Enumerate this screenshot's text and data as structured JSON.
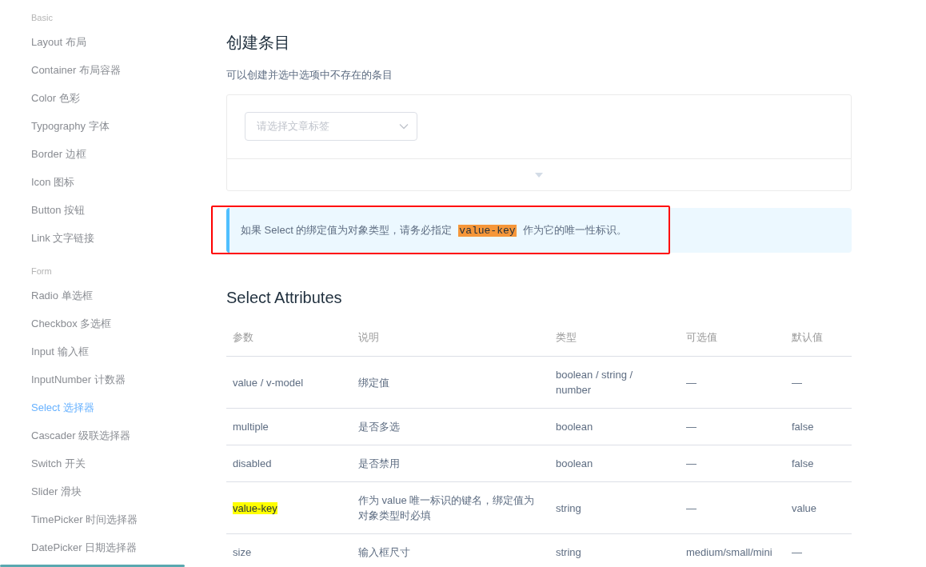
{
  "sidebar": {
    "groups": [
      {
        "title": "Basic",
        "items": [
          {
            "label": "Layout 布局",
            "selected": false
          },
          {
            "label": "Container 布局容器",
            "selected": false
          },
          {
            "label": "Color 色彩",
            "selected": false
          },
          {
            "label": "Typography 字体",
            "selected": false
          },
          {
            "label": "Border 边框",
            "selected": false
          },
          {
            "label": "Icon 图标",
            "selected": false
          },
          {
            "label": "Button 按钮",
            "selected": false
          },
          {
            "label": "Link 文字链接",
            "selected": false
          }
        ]
      },
      {
        "title": "Form",
        "items": [
          {
            "label": "Radio 单选框",
            "selected": false
          },
          {
            "label": "Checkbox 多选框",
            "selected": false
          },
          {
            "label": "Input 输入框",
            "selected": false
          },
          {
            "label": "InputNumber 计数器",
            "selected": false
          },
          {
            "label": "Select 选择器",
            "selected": true
          },
          {
            "label": "Cascader 级联选择器",
            "selected": false
          },
          {
            "label": "Switch 开关",
            "selected": false
          },
          {
            "label": "Slider 滑块",
            "selected": false
          },
          {
            "label": "TimePicker 时间选择器",
            "selected": false
          },
          {
            "label": "DatePicker 日期选择器",
            "selected": false
          }
        ]
      }
    ]
  },
  "section": {
    "title": "创建条目",
    "description": "可以创建并选中选项中不存在的条目"
  },
  "demo": {
    "select": {
      "placeholder": "请选择文章标签"
    }
  },
  "tip": {
    "before": "如果 Select 的绑定值为对象类型，请务必指定",
    "code": "value-key",
    "after": "作为它的唯一性标识。",
    "outlined": true
  },
  "attributes": {
    "title": "Select Attributes",
    "columns": [
      "参数",
      "说明",
      "类型",
      "可选值",
      "默认值"
    ],
    "rows": [
      {
        "cells": [
          "value / v-model",
          "绑定值",
          "boolean / string / number",
          "—",
          "—"
        ],
        "highlighted": false
      },
      {
        "cells": [
          "multiple",
          "是否多选",
          "boolean",
          "—",
          "false"
        ],
        "highlighted": false
      },
      {
        "cells": [
          "disabled",
          "是否禁用",
          "boolean",
          "—",
          "false"
        ],
        "highlighted": false
      },
      {
        "cells": [
          "value-key",
          "作为 value 唯一标识的键名，绑定值为对象类型时必填",
          "string",
          "—",
          "value"
        ],
        "highlighted": true
      },
      {
        "cells": [
          "size",
          "输入框尺寸",
          "string",
          "medium/small/mini",
          "—"
        ],
        "highlighted": false
      }
    ]
  }
}
